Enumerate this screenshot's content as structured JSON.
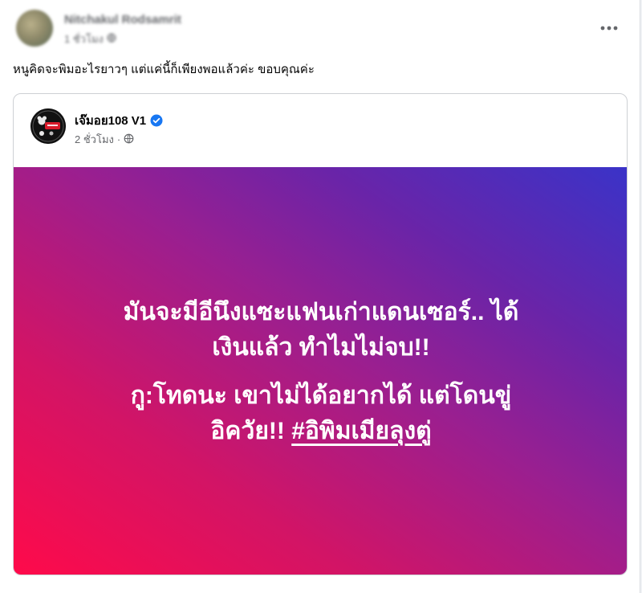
{
  "outer_post": {
    "author_name": "Nitchakul Rodsamrit",
    "time": "1 ชั่วโมง",
    "caption": "หนูคิดจะพิมอะไรยาวๆ แต่แค่นี้ก็เพียงพอแล้วค่ะ ขอบคุณค่ะ",
    "more_icon": "more-horizontal-icon",
    "privacy_icon": "globe-icon"
  },
  "shared_post": {
    "author_name": "เจ๊มอย108 V1",
    "verified_icon": "verified-badge-icon",
    "time": "2 ชั่วโมง",
    "separator": "·",
    "privacy_icon": "globe-icon",
    "avatar_icon": "page-logo-avatar",
    "banner": {
      "line1": "มันจะมีอีนึงแซะแฟนเก่าแดนเซอร์.. ได้",
      "line2": "เงินแล้ว ทำไมไม่จบ!!",
      "line3": "กู:โทดนะ เขาไม่ได้อยากได้ แต่โดนขู่",
      "line4_prefix": "อิควัย!! ",
      "hashtag": "#อิพิมเมียลุงตู่",
      "colors": {
        "start": "#ff0a4a",
        "mid": "#9a1f90",
        "end": "#3a33c8",
        "text": "#ffffff"
      }
    }
  },
  "colors": {
    "background": "#f0f2f5",
    "card": "#ffffff",
    "secondary_text": "#65676b",
    "verified": "#1877f2"
  }
}
